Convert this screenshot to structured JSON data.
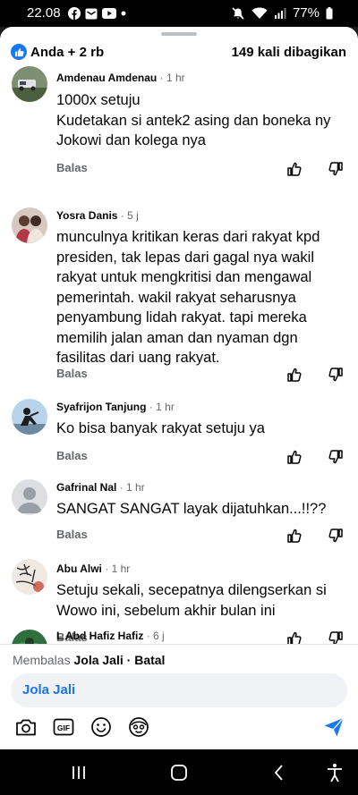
{
  "status_bar": {
    "time": "22.08",
    "battery": "77%",
    "icons": [
      "facebook-notification-icon",
      "email-notification-icon",
      "youtube-notification-icon",
      "dot-icon",
      "mute-icon",
      "wifi-icon",
      "signal-icon",
      "battery-icon"
    ]
  },
  "header": {
    "reactions_label": "Anda + 2 rb",
    "shares_label": "149 kali dibagikan"
  },
  "comments": [
    {
      "author": "Amdenau Amdenau",
      "time": "1 hr",
      "lines": [
        "1000x setuju",
        "Kudetakan si antek2 asing dan boneka ny",
        "Jokowi dan kolega nya"
      ],
      "reply_label": "Balas"
    },
    {
      "author": "Yosra Danis",
      "time": "5 j",
      "lines": [
        "munculnya kritikan keras dari rakyat kpd",
        "presiden, tak lepas dari gagal nya wakil",
        "rakyat untuk mengkritisi dan mengawal",
        "pemerintah. wakil rakyat seharusnya",
        "penyambung lidah rakyat. tapi mereka",
        "memilih jalan aman dan nyaman dgn",
        "fasilitas dari uang rakyat."
      ],
      "reply_label": "Balas"
    },
    {
      "author": "Syafrijon Tanjung",
      "time": "1 hr",
      "lines": [
        "Ko bisa banyak rakyat setuju ya"
      ],
      "reply_label": "Balas"
    },
    {
      "author": "Gafrinal Nal",
      "time": "1 hr",
      "lines": [
        "SANGAT SANGAT layak dijatuhkan...!!??"
      ],
      "reply_label": "Balas"
    },
    {
      "author": "Abu Alwi",
      "time": "1 hr",
      "lines": [
        "Setuju sekali, secepatnya dilengserkan si",
        "Wowo ini, sebelum akhir bulan ini"
      ],
      "reply_label": "Balas"
    },
    {
      "author": "L Abd Hafiz Hafiz",
      "time": "6 j",
      "lines": [],
      "reply_label": ""
    }
  ],
  "separator": "·",
  "reply_bar": {
    "prefix": "Membalas",
    "name": "Jola Jali",
    "cancel": "Batal",
    "input_value": "Jola Jali"
  },
  "colors": {
    "accent": "#1877f2",
    "secondary_text": "#65676b",
    "input_background": "#f0f2f5"
  }
}
